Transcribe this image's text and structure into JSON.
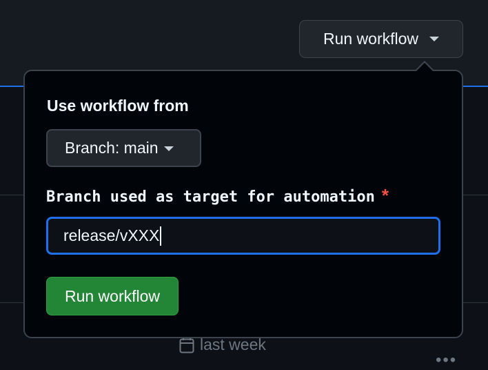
{
  "header": {
    "run_workflow_label": "Run workflow"
  },
  "popover": {
    "use_from_label": "Use workflow from",
    "branch_selector_label": "Branch: main",
    "input_label": "Branch used as target for automation",
    "required_marker": "*",
    "input_value": "release/vXXX",
    "submit_label": "Run workflow"
  },
  "background": {
    "relative_time": "last week",
    "more_label": "•••"
  },
  "colors": {
    "accent_blue": "#1f6feb",
    "primary_green": "#238636",
    "required_red": "#f85149"
  }
}
